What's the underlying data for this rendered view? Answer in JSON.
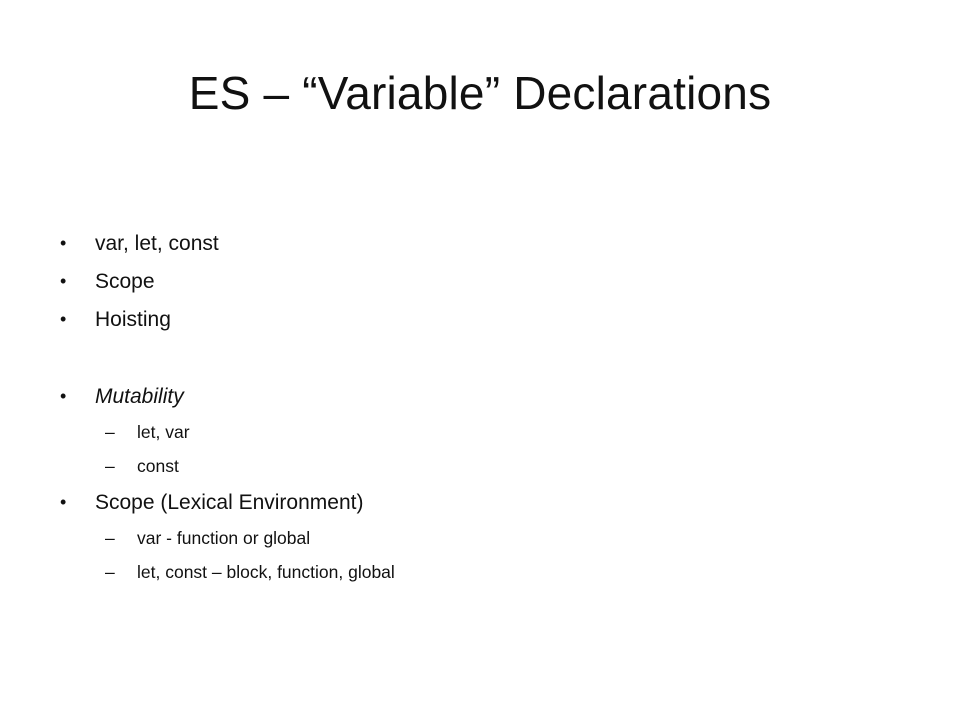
{
  "slide": {
    "title": "ES – “Variable” Declarations",
    "bullets": [
      {
        "text": "var, let, const"
      },
      {
        "text": "Scope"
      },
      {
        "text": "Hoisting"
      },
      {
        "text": "Mutability"
      },
      {
        "text": "let, var"
      },
      {
        "text": "const"
      },
      {
        "text": "Scope (Lexical Environment)"
      },
      {
        "text": "var  - function or global"
      },
      {
        "text": "let, const – block, function, global"
      }
    ],
    "bullet_glyph": "•",
    "dash_glyph": "–"
  }
}
